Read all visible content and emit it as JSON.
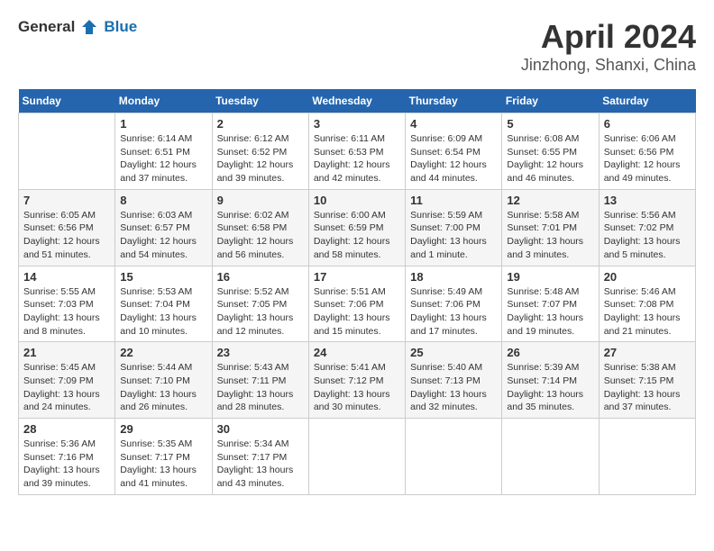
{
  "header": {
    "logo_general": "General",
    "logo_blue": "Blue",
    "month": "April 2024",
    "location": "Jinzhong, Shanxi, China"
  },
  "days_of_week": [
    "Sunday",
    "Monday",
    "Tuesday",
    "Wednesday",
    "Thursday",
    "Friday",
    "Saturday"
  ],
  "weeks": [
    [
      {
        "day": "",
        "info": ""
      },
      {
        "day": "1",
        "info": "Sunrise: 6:14 AM\nSunset: 6:51 PM\nDaylight: 12 hours\nand 37 minutes."
      },
      {
        "day": "2",
        "info": "Sunrise: 6:12 AM\nSunset: 6:52 PM\nDaylight: 12 hours\nand 39 minutes."
      },
      {
        "day": "3",
        "info": "Sunrise: 6:11 AM\nSunset: 6:53 PM\nDaylight: 12 hours\nand 42 minutes."
      },
      {
        "day": "4",
        "info": "Sunrise: 6:09 AM\nSunset: 6:54 PM\nDaylight: 12 hours\nand 44 minutes."
      },
      {
        "day": "5",
        "info": "Sunrise: 6:08 AM\nSunset: 6:55 PM\nDaylight: 12 hours\nand 46 minutes."
      },
      {
        "day": "6",
        "info": "Sunrise: 6:06 AM\nSunset: 6:56 PM\nDaylight: 12 hours\nand 49 minutes."
      }
    ],
    [
      {
        "day": "7",
        "info": "Sunrise: 6:05 AM\nSunset: 6:56 PM\nDaylight: 12 hours\nand 51 minutes."
      },
      {
        "day": "8",
        "info": "Sunrise: 6:03 AM\nSunset: 6:57 PM\nDaylight: 12 hours\nand 54 minutes."
      },
      {
        "day": "9",
        "info": "Sunrise: 6:02 AM\nSunset: 6:58 PM\nDaylight: 12 hours\nand 56 minutes."
      },
      {
        "day": "10",
        "info": "Sunrise: 6:00 AM\nSunset: 6:59 PM\nDaylight: 12 hours\nand 58 minutes."
      },
      {
        "day": "11",
        "info": "Sunrise: 5:59 AM\nSunset: 7:00 PM\nDaylight: 13 hours\nand 1 minute."
      },
      {
        "day": "12",
        "info": "Sunrise: 5:58 AM\nSunset: 7:01 PM\nDaylight: 13 hours\nand 3 minutes."
      },
      {
        "day": "13",
        "info": "Sunrise: 5:56 AM\nSunset: 7:02 PM\nDaylight: 13 hours\nand 5 minutes."
      }
    ],
    [
      {
        "day": "14",
        "info": "Sunrise: 5:55 AM\nSunset: 7:03 PM\nDaylight: 13 hours\nand 8 minutes."
      },
      {
        "day": "15",
        "info": "Sunrise: 5:53 AM\nSunset: 7:04 PM\nDaylight: 13 hours\nand 10 minutes."
      },
      {
        "day": "16",
        "info": "Sunrise: 5:52 AM\nSunset: 7:05 PM\nDaylight: 13 hours\nand 12 minutes."
      },
      {
        "day": "17",
        "info": "Sunrise: 5:51 AM\nSunset: 7:06 PM\nDaylight: 13 hours\nand 15 minutes."
      },
      {
        "day": "18",
        "info": "Sunrise: 5:49 AM\nSunset: 7:06 PM\nDaylight: 13 hours\nand 17 minutes."
      },
      {
        "day": "19",
        "info": "Sunrise: 5:48 AM\nSunset: 7:07 PM\nDaylight: 13 hours\nand 19 minutes."
      },
      {
        "day": "20",
        "info": "Sunrise: 5:46 AM\nSunset: 7:08 PM\nDaylight: 13 hours\nand 21 minutes."
      }
    ],
    [
      {
        "day": "21",
        "info": "Sunrise: 5:45 AM\nSunset: 7:09 PM\nDaylight: 13 hours\nand 24 minutes."
      },
      {
        "day": "22",
        "info": "Sunrise: 5:44 AM\nSunset: 7:10 PM\nDaylight: 13 hours\nand 26 minutes."
      },
      {
        "day": "23",
        "info": "Sunrise: 5:43 AM\nSunset: 7:11 PM\nDaylight: 13 hours\nand 28 minutes."
      },
      {
        "day": "24",
        "info": "Sunrise: 5:41 AM\nSunset: 7:12 PM\nDaylight: 13 hours\nand 30 minutes."
      },
      {
        "day": "25",
        "info": "Sunrise: 5:40 AM\nSunset: 7:13 PM\nDaylight: 13 hours\nand 32 minutes."
      },
      {
        "day": "26",
        "info": "Sunrise: 5:39 AM\nSunset: 7:14 PM\nDaylight: 13 hours\nand 35 minutes."
      },
      {
        "day": "27",
        "info": "Sunrise: 5:38 AM\nSunset: 7:15 PM\nDaylight: 13 hours\nand 37 minutes."
      }
    ],
    [
      {
        "day": "28",
        "info": "Sunrise: 5:36 AM\nSunset: 7:16 PM\nDaylight: 13 hours\nand 39 minutes."
      },
      {
        "day": "29",
        "info": "Sunrise: 5:35 AM\nSunset: 7:17 PM\nDaylight: 13 hours\nand 41 minutes."
      },
      {
        "day": "30",
        "info": "Sunrise: 5:34 AM\nSunset: 7:17 PM\nDaylight: 13 hours\nand 43 minutes."
      },
      {
        "day": "",
        "info": ""
      },
      {
        "day": "",
        "info": ""
      },
      {
        "day": "",
        "info": ""
      },
      {
        "day": "",
        "info": ""
      }
    ]
  ]
}
